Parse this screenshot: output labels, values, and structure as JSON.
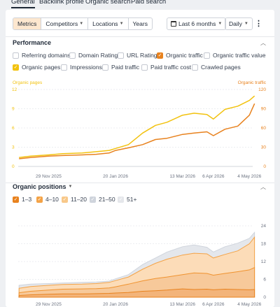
{
  "tabs": [
    {
      "label": "General",
      "active": true
    },
    {
      "label": "Backlink profile",
      "active": false
    },
    {
      "label": "Organic search",
      "active": false
    },
    {
      "label": "Paid search",
      "active": false
    }
  ],
  "toolbar": {
    "metrics": "Metrics",
    "competitors": "Competitors",
    "locations": "Locations",
    "years": "Years",
    "period": "Last 6 months",
    "granularity": "Daily"
  },
  "performance": {
    "title": "Performance",
    "checkboxes": [
      {
        "label": "Referring domains",
        "checked": false
      },
      {
        "label": "Domain Rating",
        "checked": false
      },
      {
        "label": "URL Rating",
        "checked": false
      },
      {
        "label": "Organic traffic",
        "checked": true,
        "color": "#e8821e"
      },
      {
        "label": "Organic traffic value",
        "checked": false
      },
      {
        "label": "Organic pages",
        "checked": true,
        "color": "#f2c20f"
      },
      {
        "label": "Impressions",
        "checked": false
      },
      {
        "label": "Paid traffic",
        "checked": false
      },
      {
        "label": "Paid traffic cost",
        "checked": false
      },
      {
        "label": "Crawled pages",
        "checked": false
      }
    ],
    "left_axis_label": "Organic pages",
    "right_axis_label": "Organic traffic",
    "left_ticks": [
      "12",
      "9",
      "6",
      "3",
      "0"
    ],
    "right_ticks": [
      "120",
      "90",
      "60",
      "30",
      "0"
    ],
    "x_ticks": [
      "29 Nov 2025",
      "20 Jan 2026",
      "13 Mar 2026",
      "6 Apr 2026",
      "4 May 2026"
    ]
  },
  "positions": {
    "title": "Organic positions",
    "legend": [
      {
        "label": "1–3",
        "checked": true,
        "color": "#e8821e"
      },
      {
        "label": "4–10",
        "checked": true,
        "color": "#f4a347"
      },
      {
        "label": "11–20",
        "checked": true,
        "color": "#f8c889"
      },
      {
        "label": "21–50",
        "checked": true,
        "color": "#cfd4dc"
      },
      {
        "label": "51+",
        "checked": false,
        "color": "#e5e7eb"
      }
    ],
    "right_ticks": [
      "24",
      "18",
      "12",
      "6",
      "0"
    ],
    "x_ticks": [
      "29 Nov 2025",
      "20 Jan 2026",
      "13 Mar 2026",
      "6 Apr 2026",
      "4 May 2026"
    ]
  },
  "colors": {
    "organic_traffic": "#e8821e",
    "organic_pages": "#f2c20f",
    "accent": "#f28c28"
  },
  "chart_data": [
    {
      "type": "line",
      "x": [
        "2025-11-06",
        "2025-11-15",
        "2025-11-29",
        "2025-12-10",
        "2025-12-25",
        "2026-01-05",
        "2026-01-15",
        "2026-01-20",
        "2026-01-30",
        "2026-02-10",
        "2026-02-20",
        "2026-03-01",
        "2026-03-13",
        "2026-03-22",
        "2026-04-01",
        "2026-04-06",
        "2026-04-15",
        "2026-04-25",
        "2026-05-04",
        "2026-05-08"
      ],
      "ylim_left": [
        0,
        12
      ],
      "ylim_right": [
        0,
        120
      ],
      "series": [
        {
          "name": "Organic pages",
          "axis": "left",
          "values": [
            1.4,
            1.6,
            1.8,
            2.0,
            2.1,
            2.3,
            2.5,
            2.8,
            3.4,
            5.2,
            6.4,
            6.9,
            8.0,
            8.3,
            8.1,
            7.4,
            8.9,
            9.4,
            10.3,
            11.0
          ]
        },
        {
          "name": "Organic traffic",
          "axis": "right",
          "values": [
            12,
            14,
            16,
            17,
            18,
            19,
            21,
            25,
            29,
            34,
            42,
            44,
            50,
            52,
            54,
            48,
            58,
            63,
            80,
            98
          ]
        }
      ]
    },
    {
      "type": "area",
      "x": [
        "2025-11-06",
        "2025-11-15",
        "2025-11-29",
        "2025-12-10",
        "2025-12-25",
        "2026-01-05",
        "2026-01-15",
        "2026-01-20",
        "2026-01-30",
        "2026-02-10",
        "2026-02-20",
        "2026-03-01",
        "2026-03-13",
        "2026-03-22",
        "2026-04-01",
        "2026-04-06",
        "2026-04-15",
        "2026-04-25",
        "2026-05-04",
        "2026-05-08"
      ],
      "ylim": [
        0,
        24
      ],
      "series": [
        {
          "name": "1–3",
          "values": [
            0.6,
            0.8,
            1.0,
            1.1,
            1.1,
            1.2,
            1.3,
            1.4,
            1.6,
            2.0,
            2.2,
            2.4,
            2.8,
            2.6,
            2.7,
            2.5,
            2.7,
            2.6,
            2.5,
            2.6
          ]
        },
        {
          "name": "4–10",
          "values": [
            1.5,
            2.0,
            2.4,
            2.7,
            2.8,
            2.9,
            3.1,
            3.5,
            4.4,
            5.5,
            6.3,
            6.8,
            7.6,
            8.2,
            8.0,
            7.4,
            8.0,
            8.6,
            9.2,
            10.0
          ]
        },
        {
          "name": "11–20",
          "values": [
            3.0,
            3.6,
            4.0,
            4.3,
            4.4,
            4.6,
            5.0,
            5.6,
            6.8,
            9.4,
            11.4,
            12.8,
            14.2,
            14.8,
            14.6,
            13.2,
            14.4,
            15.6,
            18.0,
            20.2
          ]
        },
        {
          "name": "21–50",
          "values": [
            4.0,
            4.4,
            4.6,
            4.8,
            5.0,
            5.1,
            5.4,
            6.2,
            7.6,
            11.0,
            13.2,
            15.2,
            17.0,
            17.6,
            16.8,
            15.2,
            17.0,
            18.2,
            19.8,
            21.8
          ]
        }
      ]
    }
  ]
}
